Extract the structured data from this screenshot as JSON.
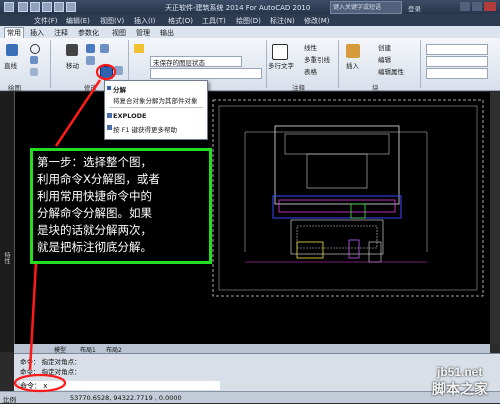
{
  "window": {
    "title": "天正软件-建筑系统 2014  For AutoCAD 2010",
    "search_hint": "键入关键字或短语",
    "user_hint": "登录"
  },
  "menu": [
    "文件(F)",
    "编辑(E)",
    "视图(V)",
    "插入(I)",
    "格式(O)",
    "工具(T)",
    "绘图(D)",
    "标注(N)",
    "修改(M)"
  ],
  "ribbon_tabs": [
    "常用",
    "插入",
    "注释",
    "参数化",
    "视图",
    "管理",
    "输出"
  ],
  "ribbon": {
    "line": "直线",
    "move": "移动",
    "unsaved_layer_state": "未保存的图层状态",
    "multiline_text": "多行文字",
    "linear": "线性",
    "multileader": "多重引线",
    "table": "表格",
    "insert": "插入",
    "create": "创建",
    "edit": "编辑",
    "edit_attributes": "编辑属性",
    "panel_draw": "绘图",
    "panel_modify": "修改",
    "panel_annotation": "注释",
    "panel_block": "块"
  },
  "dropdown": {
    "title": "分解",
    "desc": "将复合对象分解为其部件对象",
    "command": "EXPLODE",
    "help": "按 F1 键获得更多帮助"
  },
  "annotation": {
    "lines": [
      "第一步：选择整个图，",
      "利用命令X分解图，或者",
      "利用常用快捷命令中的",
      "分解命令分解图。如果",
      "是块的话就分解两次，",
      "就是把标注彻底分解。"
    ],
    "border_color": "#22dd22",
    "arrow_color": "#ff1a1a"
  },
  "left_side_label": "特性",
  "layout_tabs": [
    "模型",
    "布局1",
    "布局2"
  ],
  "command_window": {
    "line1": "命令： 指定对角点：",
    "line2": "命令： 指定对角点：",
    "prompt": "命令： x"
  },
  "status": {
    "label": "比例",
    "coords": "53770.6528, 94322.7719 , 0.0000"
  },
  "watermark": {
    "site": "jb51.net",
    "name": "脚本之家"
  }
}
